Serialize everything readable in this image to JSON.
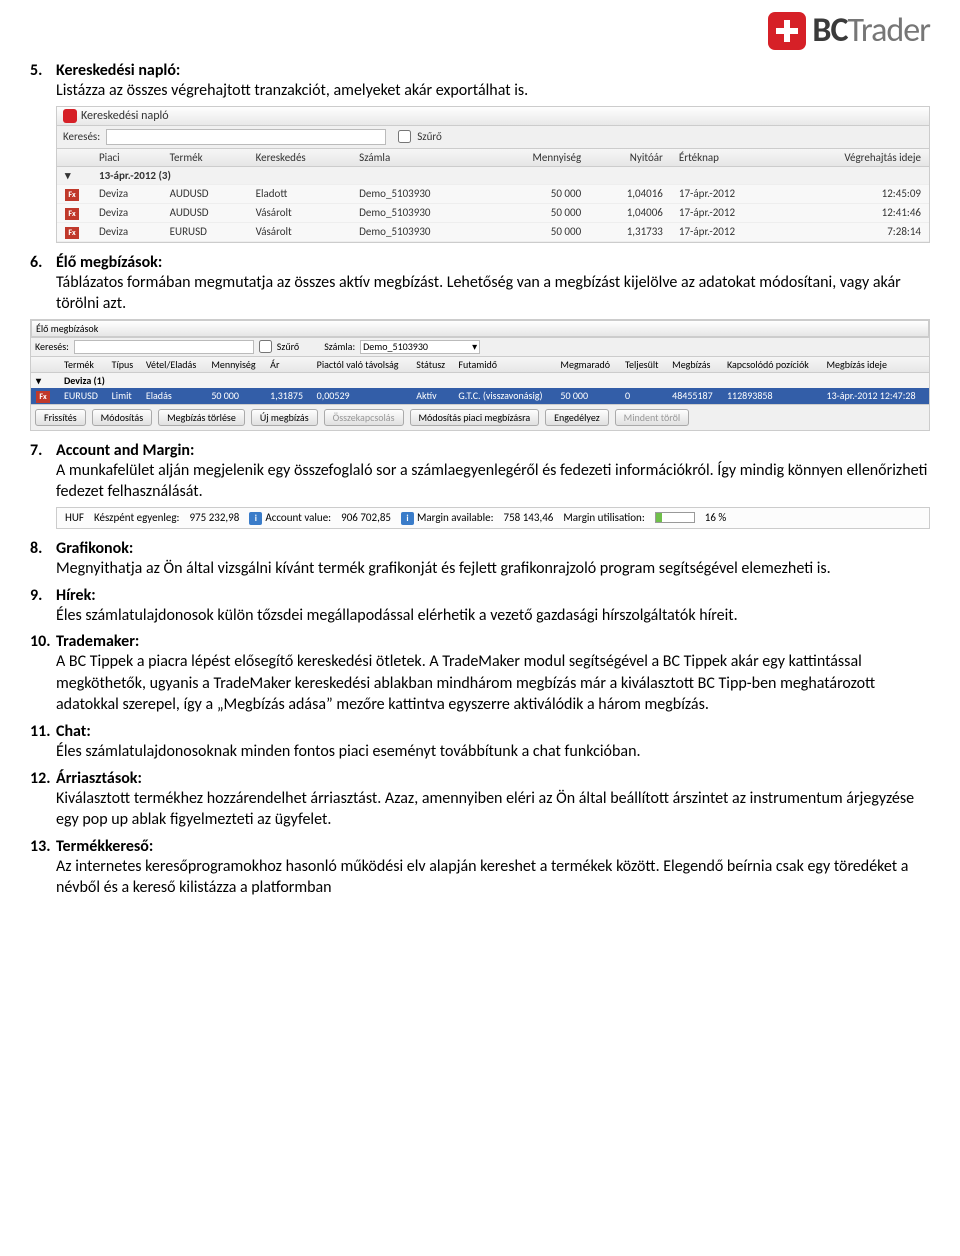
{
  "logo": {
    "bc": "BC",
    "trader": "Trader"
  },
  "items": [
    {
      "num": "5",
      "title": "Kereskedési napló:",
      "body": "Listázza az összes végrehajtott tranzakciót, amelyeket akár exportálhat is.",
      "shot1": {
        "title": "Kereskedési napló",
        "search_label": "Keresés:",
        "filter_label": "Szűrő",
        "headers": [
          "Piaci",
          "Termék",
          "Kereskedés",
          "Számla",
          "Mennyiség",
          "Nyitóár",
          "Értéknap",
          "Végrehajtás ideje"
        ],
        "group": "13-ápr.-2012 (3)",
        "rows": [
          [
            "Deviza",
            "AUDUSD",
            "Eladott",
            "Demo_5103930",
            "50 000",
            "1,04016",
            "17-ápr.-2012",
            "12:45:09"
          ],
          [
            "Deviza",
            "AUDUSD",
            "Vásárolt",
            "Demo_5103930",
            "50 000",
            "1,04006",
            "17-ápr.-2012",
            "12:41:46"
          ],
          [
            "Deviza",
            "EURUSD",
            "Vásárolt",
            "Demo_5103930",
            "50 000",
            "1,31733",
            "17-ápr.-2012",
            "7:28:14"
          ]
        ]
      }
    },
    {
      "num": "6",
      "title": "Élő megbízások:",
      "body": "Táblázatos formában megmutatja az összes aktív megbízást. Lehetőség van a megbízást kijelölve az adatokat módosítani, vagy akár törölni azt.",
      "shot2": {
        "title": "Élő megbízások",
        "search_label": "Keresés:",
        "filter_label": "Szűrő",
        "acct_label": "Számla:",
        "acct_val": "Demo_5103930",
        "headers": [
          "Termék",
          "Típus",
          "Vétel/Eladás",
          "Mennyiség",
          "Ár",
          "Piactól való távolság",
          "Státusz",
          "Futamidő",
          "Megmaradó",
          "Teljesült",
          "Megbízás",
          "Kapcsolódó pozíciók",
          "Megbízás ideje"
        ],
        "group": "Deviza (1)",
        "row": [
          "EURUSD",
          "Limit",
          "Eladás",
          "50 000",
          "1,31875",
          "0,00529",
          "Aktív",
          "G.T.C. (visszavonásig)",
          "50 000",
          "0",
          "48455187",
          "112893858",
          "13-ápr.-2012 12:47:28"
        ],
        "buttons": [
          "Frissítés",
          "Módosítás",
          "Megbízás törlése",
          "Új megbízás",
          "Összekapcsolás",
          "Módosítás piaci megbízásra",
          "Engedélyez",
          "Mindent töröl"
        ]
      }
    },
    {
      "num": "7",
      "title": "Account and Margin:",
      "body": "A munkafelület alján megjelenik egy összefoglaló sor a számlaegyenlegéről és fedezeti információkról. Így mindig könnyen ellenőrizheti fedezet felhasználását.",
      "acctbar": {
        "ccy": "HUF",
        "l1": "Készpént egyenleg:",
        "v1": "975 232,98",
        "l2": "Account value:",
        "v2": "906 702,85",
        "l3": "Margin available:",
        "v3": "758 143,46",
        "l4": "Margin utilisation:",
        "v4": "16 %"
      }
    },
    {
      "num": "8",
      "title": "Grafikonok:",
      "body": "Megnyithatja az Ön által vizsgálni kívánt termék grafikonját és fejlett grafikonrajzoló program segítségével elemezheti is."
    },
    {
      "num": "9",
      "title": "Hírek:",
      "body": "Éles számlatulajdonosok külön tőzsdei megállapodással elérhetik a vezető gazdasági hírszolgáltatók híreit."
    },
    {
      "num": "10",
      "title": "Trademaker:",
      "body": "A BC Tippek a piacra lépést elősegítő kereskedési ötletek. A TradeMaker modul segítségével a BC Tippek akár egy kattintással megköthetők, ugyanis a TradeMaker kereskedési ablakban mindhárom megbízás már a kiválasztott BC Tipp-ben meghatározott adatokkal szerepel, így a „Megbízás adása” mezőre kattintva egyszerre aktiválódik a három megbízás."
    },
    {
      "num": "11",
      "title": "Chat:",
      "body": "Éles számlatulajdonosoknak minden fontos piaci eseményt továbbítunk a chat funkcióban."
    },
    {
      "num": "12",
      "title": "Árriasztások:",
      "body": "Kiválasztott termékhez hozzárendelhet árriasztást. Azaz, amennyiben eléri az Ön által beállított árszintet az instrumentum árjegyzése egy pop up ablak figyelmezteti az ügyfelet."
    },
    {
      "num": "13",
      "title": "Termékkereső:",
      "body": "Az internetes keresőprogramokhoz hasonló működési elv alapján kereshet a termékek között. Elegendő beírnia csak egy töredéket a névből és a kereső kilistázza a platformban"
    }
  ]
}
